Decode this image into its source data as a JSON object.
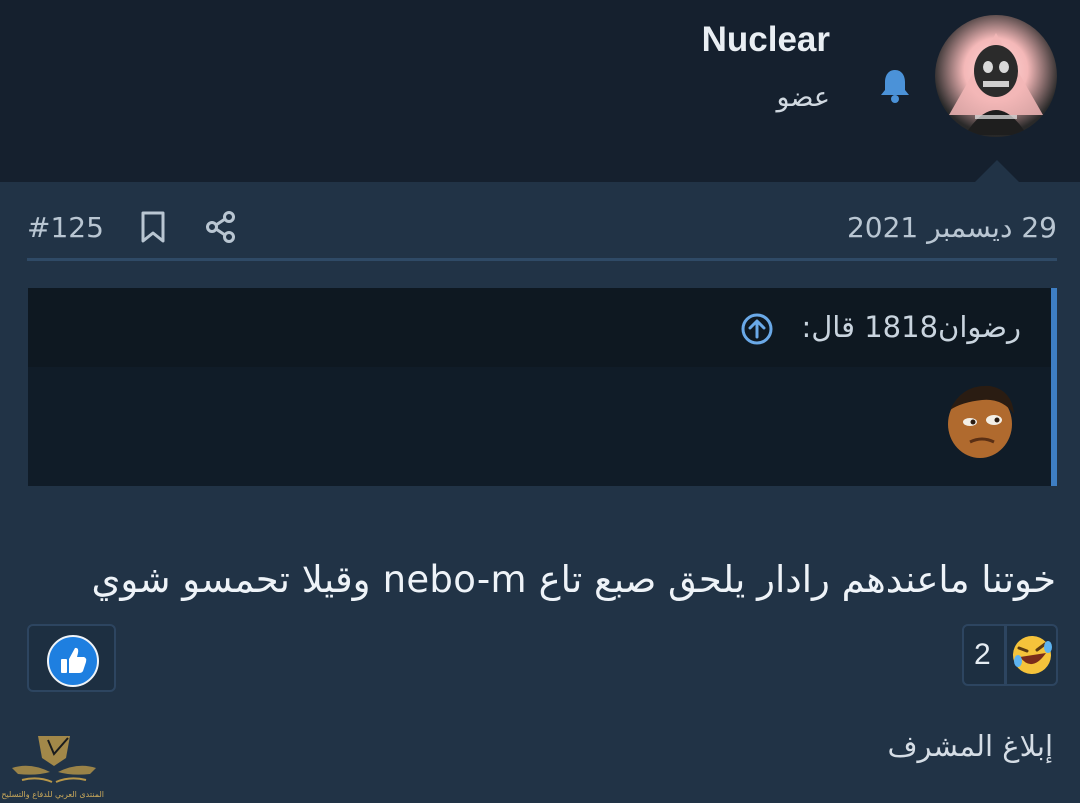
{
  "user": {
    "name": "Nuclear",
    "role": "عضو",
    "avatar_icon": "skull-avatar",
    "notification_icon": "bell-icon"
  },
  "post": {
    "date": "29 ديسمبر 2021",
    "number": "#125",
    "bookmark_icon": "bookmark-icon",
    "share_icon": "share-icon"
  },
  "quote": {
    "author_line": "رضوان1818 قال:",
    "jump_icon": "arrow-up-circle-icon",
    "emoji": "thinking-face-sticker"
  },
  "message": {
    "text": "خوتنا ماعندهم رادار يلحق صبع تاع nebo-m وقيلا تحمسو شوي"
  },
  "reactions": {
    "like_icon": "thumbs-up-icon",
    "summary_count": "2",
    "summary_emoji": "laughing-emoji"
  },
  "footer": {
    "report_label": "إبلاغ المشرف",
    "watermark_text": "المنتدى العربي للدفاع والتسليح"
  },
  "colors": {
    "header_bg": "#15202e",
    "page_bg": "#213346",
    "quote_bg": "#101c28",
    "accent_blue": "#3e7ec3",
    "icon_blue": "#5aa2e6"
  }
}
